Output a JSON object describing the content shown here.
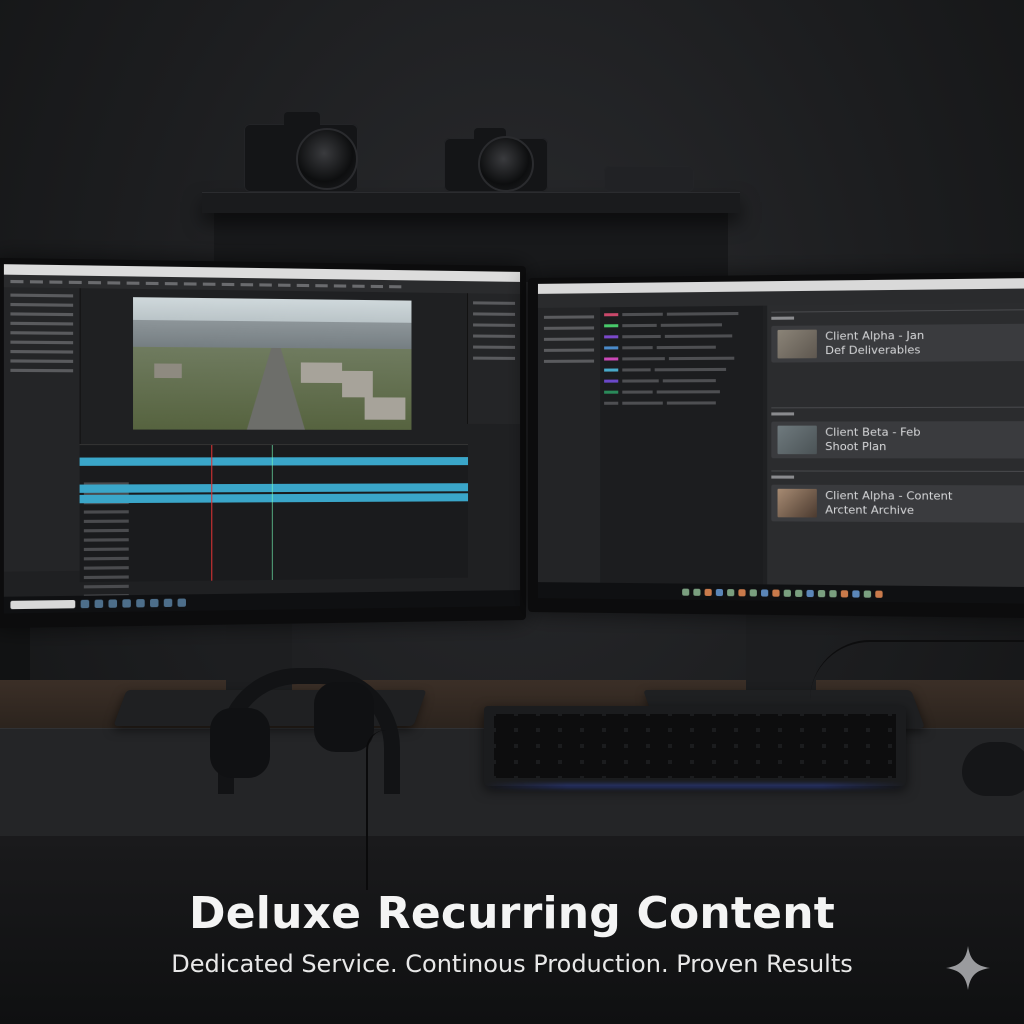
{
  "caption": {
    "headline": "Deluxe Recurring Content",
    "subline": "Dedicated Service. Continous Production. Proven Results"
  },
  "deliverables": [
    {
      "line1": "Client Alpha - Jan",
      "line2": "Def Deliverables"
    },
    {
      "line1": "Client Beta - Feb",
      "line2": "Shoot Plan"
    },
    {
      "line1": "Client Alpha - Content",
      "line2": "Arctent Archive"
    }
  ],
  "icons": {
    "corner": "sparkle-icon"
  },
  "colors": {
    "timeline_clip": "#3aa6c9",
    "playhead": "#dd3333",
    "keyboard_glow": "#3a55d8"
  }
}
